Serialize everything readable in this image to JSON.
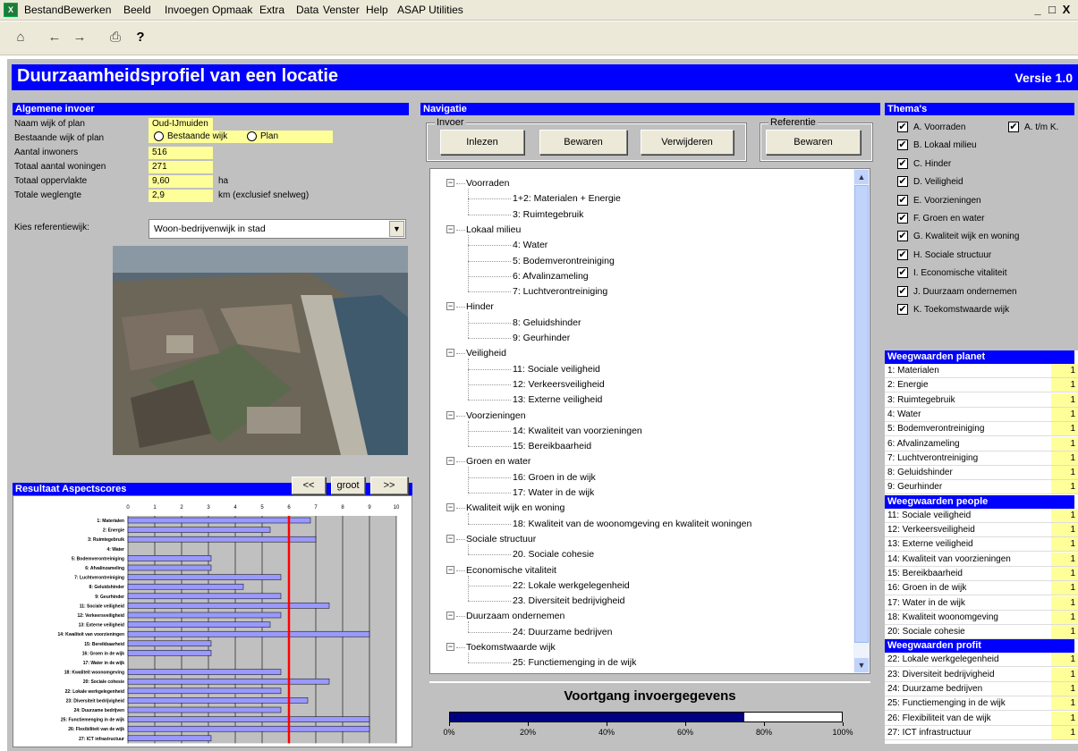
{
  "menu": [
    "Bestand",
    "Bewerken",
    "Beeld",
    "Invoegen",
    "Opmaak",
    "Extra",
    "Data",
    "Venster",
    "Help",
    "ASAP Utilities"
  ],
  "window_controls": [
    "_",
    "□",
    "X"
  ],
  "header": {
    "title": "Duurzaamheidsprofiel van een locatie",
    "version": "Versie 1.0"
  },
  "algemene": {
    "heading": "Algemene invoer",
    "rows": [
      {
        "label": "Naam wijk of plan",
        "value": "Oud-IJmuiden",
        "unit": ""
      },
      {
        "label": "Bestaande wijk of plan",
        "value": "",
        "unit": ""
      },
      {
        "label": "Aantal inwoners",
        "value": "516",
        "unit": ""
      },
      {
        "label": "Totaal aantal woningen",
        "value": "271",
        "unit": ""
      },
      {
        "label": "Totaal oppervlakte",
        "value": "9,60",
        "unit": "ha"
      },
      {
        "label": "Totale weglengte",
        "value": "2,9",
        "unit": "km (exclusief snelweg)"
      }
    ],
    "radio_existing": "Bestaande wijk",
    "radio_plan": "Plan",
    "ref_label": "Kies referentiewijk:",
    "ref_value": "Woon-bedrijvenwijk in stad"
  },
  "resultaat": {
    "heading": "Resultaat Aspectscores",
    "prev": "<<",
    "big": "groot",
    "next": ">>"
  },
  "chart_data": {
    "type": "bar",
    "categories": [
      "1: Materialen",
      "2: Energie",
      "3: Ruimtegebruik",
      "4: Water",
      "5: Bodemverontreiniging",
      "6: Afvalinzameling",
      "7: Luchtverontreiniging",
      "8: Geluidshinder",
      "9: Geurhinder",
      "11: Sociale veiligheid",
      "12: Verkeersveiligheid",
      "13: Externe veiligheid",
      "14: Kwaliteit van voorzieningen",
      "15: Bereikbaarheid",
      "16: Groen in de wijk",
      "17: Water in de wijk",
      "18: Kwaliteit woonomgeving",
      "20: Sociale cohesie",
      "22: Lokale werkgelegenheid",
      "23: Diversiteit bedrijvigheid",
      "24: Duurzame bedrijven",
      "25: Functiemenging in de wijk",
      "26: Flexibiliteit van de wijk",
      "27: ICT infrastructuur"
    ],
    "series": [
      {
        "values": [
          6.8,
          5.3,
          7.0,
          0,
          3.1,
          3.1,
          5.7,
          4.3,
          5.7,
          7.5,
          5.7,
          5.3,
          9.0,
          3.1,
          3.1,
          0,
          5.7,
          7.5,
          5.7,
          6.7,
          5.7,
          9.0,
          9.0,
          3.1
        ]
      }
    ],
    "ylim": [
      0,
      10
    ],
    "ticks": [
      "0",
      "1",
      "2",
      "3",
      "4",
      "5",
      "6",
      "7",
      "8",
      "9",
      "10"
    ],
    "reference_line": 6,
    "bar_color": "#9999ff",
    "ref_color": "#ff0000"
  },
  "navigatie": {
    "heading": "Navigatie",
    "invoer_group": "Invoer",
    "referentie_group": "Referentie",
    "btn_inlezen": "Inlezen",
    "btn_bewaren": "Bewaren",
    "btn_verwijderen": "Verwijderen",
    "btn_ref_bewaren": "Bewaren",
    "tree": [
      {
        "label": "Voorraden",
        "children": [
          "1+2: Materialen + Energie",
          "3: Ruimtegebruik"
        ]
      },
      {
        "label": "Lokaal milieu",
        "children": [
          "4: Water",
          "5: Bodemverontreiniging",
          "6: Afvalinzameling",
          "7: Luchtverontreiniging"
        ]
      },
      {
        "label": "Hinder",
        "children": [
          "8: Geluidshinder",
          "9: Geurhinder"
        ]
      },
      {
        "label": "Veiligheid",
        "children": [
          "11: Sociale veiligheid",
          "12: Verkeersveiligheid",
          "13: Externe veiligheid"
        ]
      },
      {
        "label": "Voorzieningen",
        "children": [
          "14: Kwaliteit van voorzieningen",
          "15: Bereikbaarheid"
        ]
      },
      {
        "label": "Groen en water",
        "children": [
          "16: Groen in de wijk",
          "17: Water in de wijk"
        ]
      },
      {
        "label": "Kwaliteit wijk en woning",
        "children": [
          "18: Kwaliteit van de woonomgeving en kwaliteit woningen"
        ]
      },
      {
        "label": "Sociale structuur",
        "children": [
          "20. Sociale cohesie"
        ]
      },
      {
        "label": "Economische vitaliteit",
        "children": [
          "22: Lokale werkgelegenheid",
          "23. Diversiteit bedrijvigheid"
        ]
      },
      {
        "label": "Duurzaam ondernemen",
        "children": [
          "24: Duurzame bedrijven"
        ]
      },
      {
        "label": "Toekomstwaarde wijk",
        "children": [
          "25: Functiemenging in de wijk"
        ]
      }
    ]
  },
  "voortgang": {
    "title": "Voortgang invoergegevens",
    "progress": 0.75,
    "ticks": [
      "0%",
      "20%",
      "40%",
      "60%",
      "80%",
      "100%"
    ]
  },
  "themas": {
    "heading": "Thema's",
    "all_label": "A. t/m K.",
    "items": [
      "A. Voorraden",
      "B. Lokaal milieu",
      "C. Hinder",
      "D. Veiligheid",
      "E. Voorzieningen",
      "F. Groen en water",
      "G. Kwaliteit wijk en woning",
      "H. Sociale structuur",
      "I. Economische vitaliteit",
      "J. Duurzaam ondernemen",
      "K. Toekomstwaarde wijk"
    ],
    "check": "✔"
  },
  "weegwaarden": [
    {
      "heading": "Weegwaarden planet",
      "rows": [
        [
          "1: Materialen",
          "1"
        ],
        [
          "2: Energie",
          "1"
        ],
        [
          "3: Ruimtegebruik",
          "1"
        ],
        [
          "4: Water",
          "1"
        ],
        [
          "5: Bodemverontreiniging",
          "1"
        ],
        [
          "6: Afvalinzameling",
          "1"
        ],
        [
          "7: Luchtverontreiniging",
          "1"
        ],
        [
          "8: Geluidshinder",
          "1"
        ],
        [
          "9: Geurhinder",
          "1"
        ]
      ]
    },
    {
      "heading": "Weegwaarden people",
      "rows": [
        [
          "11: Sociale veiligheid",
          "1"
        ],
        [
          "12: Verkeersveiligheid",
          "1"
        ],
        [
          "13: Externe veiligheid",
          "1"
        ],
        [
          "14: Kwaliteit van voorzieningen",
          "1"
        ],
        [
          "15: Bereikbaarheid",
          "1"
        ],
        [
          "16: Groen in de wijk",
          "1"
        ],
        [
          "17: Water in de wijk",
          "1"
        ],
        [
          "18: Kwaliteit woonomgeving",
          "1"
        ],
        [
          "20: Sociale cohesie",
          "1"
        ]
      ]
    },
    {
      "heading": "Weegwaarden profit",
      "rows": [
        [
          "22: Lokale werkgelegenheid",
          "1"
        ],
        [
          "23: Diversiteit bedrijvigheid",
          "1"
        ],
        [
          "24: Duurzame bedrijven",
          "1"
        ],
        [
          "25: Functiemenging in de wijk",
          "1"
        ],
        [
          "26: Flexibiliteit van de wijk",
          "1"
        ],
        [
          "27: ICT infrastructuur",
          "1"
        ]
      ]
    }
  ]
}
